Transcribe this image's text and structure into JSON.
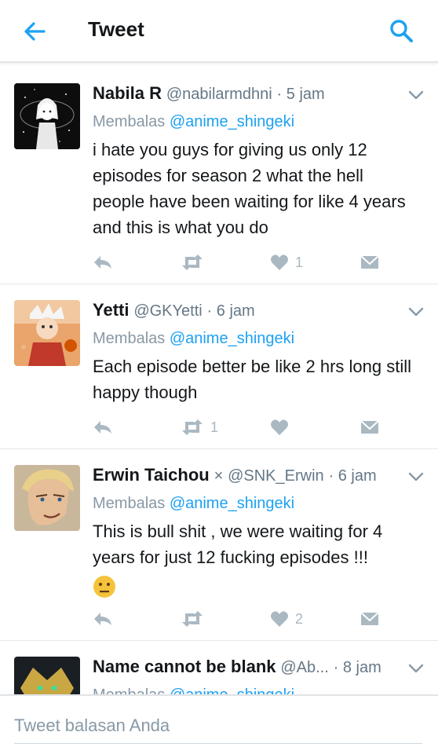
{
  "header": {
    "title": "Tweet",
    "back_icon": "back-arrow-icon",
    "search_icon": "search-icon",
    "accent_color": "#1da1f2"
  },
  "tweets": [
    {
      "name": "Nabila R",
      "handle": "@nabilarmdhni",
      "time": "· 5 jam",
      "reply_prefix": "Membalas ",
      "reply_mention": "@anime_shingeki",
      "text": "i hate you guys for giving us only 12 episodes for season 2 what the hell people have been waiting for like 4 years and this is what you do",
      "retweet_count": "",
      "like_count": "1"
    },
    {
      "name": "Yetti",
      "handle": "@GKYetti",
      "time": "· 6 jam",
      "reply_prefix": "Membalas ",
      "reply_mention": "@anime_shingeki",
      "text": "Each episode better be like 2 hrs long still happy though",
      "retweet_count": "1",
      "like_count": ""
    },
    {
      "name": "Erwin Taichou",
      "name_mark": "×",
      "handle": "@SNK_Erwin",
      "time": "· 6 jam",
      "reply_prefix": "Membalas ",
      "reply_mention": "@anime_shingeki",
      "text": "This is bull shit , we were waiting for 4 years for just 12 fucking episodes !!!",
      "emoji": "neutral-face-emoji",
      "retweet_count": "",
      "like_count": "2"
    },
    {
      "name": "Name cannot be blank",
      "handle": "@Ab...",
      "time": "· 8 jam",
      "reply_prefix": "Membalas ",
      "reply_mention": "@anime_shingeki"
    }
  ],
  "compose": {
    "placeholder": "Tweet balasan Anda",
    "value": ""
  },
  "icons": [
    "reply-icon",
    "retweet-icon",
    "like-icon",
    "direct-message-icon",
    "chevron-down-icon"
  ]
}
